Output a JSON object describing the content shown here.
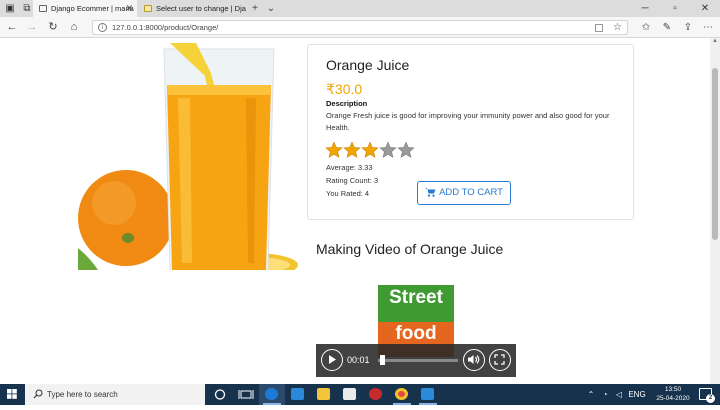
{
  "browser": {
    "tabs": [
      {
        "title": "Django Ecommer | mana",
        "active": true
      },
      {
        "title": "Select user to change | Djan",
        "active": false
      }
    ],
    "address": {
      "url": "127.0.0.1:8000/product/Orange/"
    },
    "icons": {
      "back": "back-arrow-icon",
      "forward": "forward-arrow-icon",
      "refresh": "refresh-icon",
      "home": "home-icon",
      "favorites": "favorites-star-icon",
      "hub": "hub-icon",
      "notes": "pen-icon",
      "share": "share-icon",
      "more": "ellipsis-icon"
    }
  },
  "product": {
    "name": "Orange Juice",
    "price": "₹30.0",
    "description_heading": "Description",
    "description": "Orange Fresh juice is good for improving your immunity power and also good for your Health.",
    "rating": {
      "stars_filled": 3,
      "stars_total": 5,
      "average": "Average: 3.33",
      "count": "Rating Count: 3",
      "user": "You Rated: 4"
    },
    "cart_button": "ADD TO CART",
    "image_icon": "orange-juice-image"
  },
  "video_section": {
    "heading": "Making Video of Orange Juice",
    "thumbnail": {
      "line1": "Street",
      "line2": "food"
    },
    "current_time": "00:01",
    "progress": 0.02
  },
  "taskbar": {
    "search_placeholder": "Type here to search",
    "language": "ENG",
    "time": "13:50",
    "date": "25-04-2020",
    "notification_count": "2"
  },
  "colors": {
    "price": "#f0a500",
    "button_accent": "#2a7bd4",
    "star_filled": "#f0a500",
    "star_empty": "#9a9a9a",
    "taskbar": "#17324d"
  }
}
